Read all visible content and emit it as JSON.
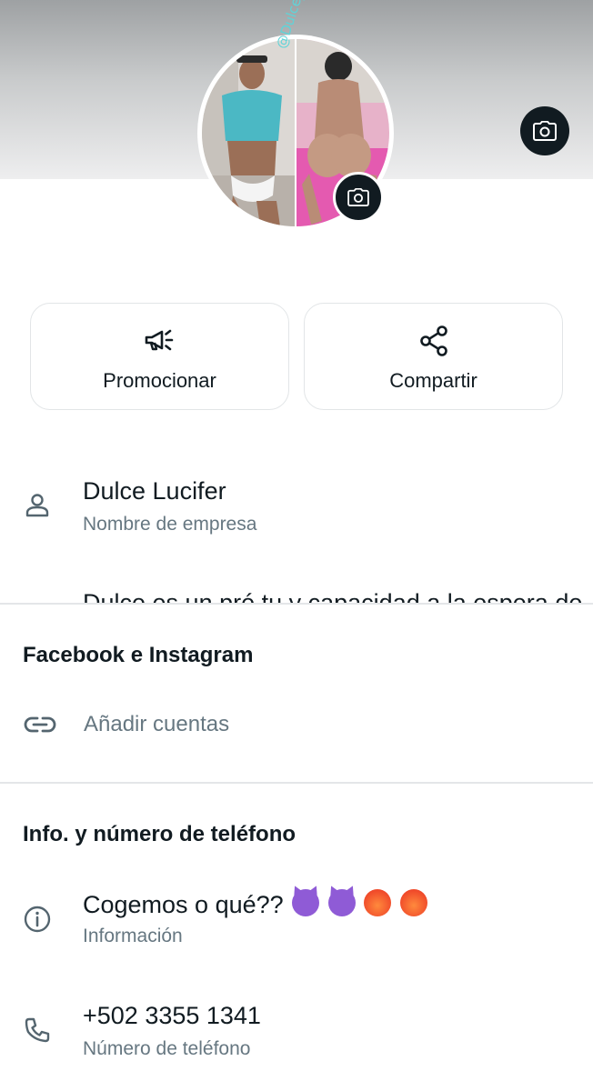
{
  "profile": {
    "watermark": "@Dulce_Lucifer"
  },
  "icons": {
    "cover_camera": "camera-icon",
    "avatar_camera": "camera-icon",
    "promote": "megaphone-icon",
    "share": "share-icon",
    "business_name": "person-icon",
    "accounts": "link-icon",
    "about": "info-icon",
    "phone": "phone-icon"
  },
  "actions": {
    "promote_label": "Promocionar",
    "share_label": "Compartir"
  },
  "business": {
    "name": "Dulce Lucifer",
    "name_caption": "Nombre de empresa",
    "clipped_text": "Dulce es un pré tu y capacidad a la espera de"
  },
  "facebook_instagram": {
    "title": "Facebook e Instagram",
    "add_accounts": "Añadir cuentas"
  },
  "info_section": {
    "title": "Info. y número de teléfono",
    "about_text": "Cogemos o qué??",
    "about_caption": "Información",
    "phone": "+502 3355 1341",
    "phone_caption": "Número de teléfono"
  },
  "colors": {
    "primary_text": "#111b21",
    "secondary_text": "#667781",
    "icon_dark": "#111b21",
    "divider": "#e4e6e8"
  }
}
